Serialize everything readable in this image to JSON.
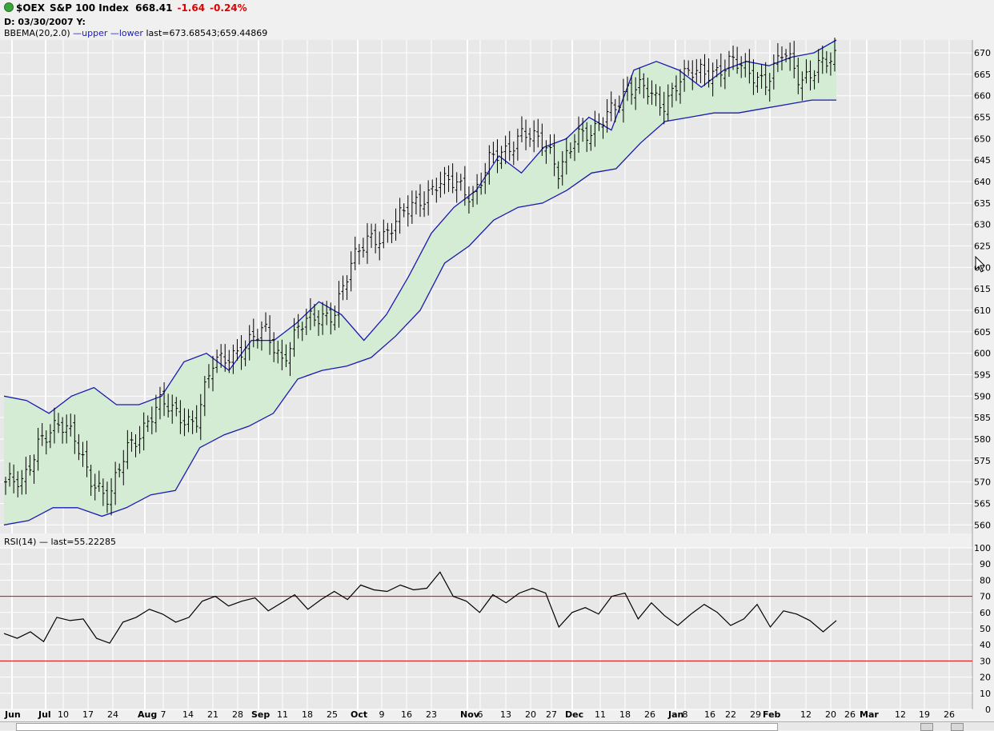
{
  "header": {
    "symbol": "$OEX",
    "name": "S&P 100 Index",
    "price": "668.41",
    "change": "-1.64",
    "change_pct": "-0.24%",
    "date_line": "D: 03/30/2007 Y:",
    "indicator_name": "BBEMA(20,2.0)",
    "upper_label": "upper",
    "lower_label": "lower",
    "last_label": "last=673.68543;659.44869",
    "status_color": "#3aa63a"
  },
  "rsi_panel": {
    "label": "RSI(14)",
    "last_label": "last=55.22285"
  },
  "colors": {
    "band_fill": "#d4ecd4",
    "band_line": "#1a1ab0",
    "price_bar": "#000000",
    "rsi_line": "#000000",
    "rsi_threshold": "#d40000",
    "grid": "#ffffff",
    "panel_bg": "#e8e8e8",
    "change_color": "#e00000"
  },
  "chart_data": [
    {
      "type": "line",
      "title": "$OEX S&P 100 Index",
      "panel": "price",
      "y_axis_side": "right",
      "ylim": [
        558,
        673
      ],
      "yticks": [
        560,
        565,
        570,
        575,
        580,
        585,
        590,
        595,
        600,
        605,
        610,
        615,
        620,
        625,
        630,
        635,
        640,
        645,
        650,
        655,
        660,
        665,
        670
      ],
      "grid": true,
      "x_labels": [
        "Jun",
        "Jul",
        "10",
        "17",
        "24",
        "Aug",
        "7",
        "14",
        "21",
        "28",
        "Sep",
        "11",
        "18",
        "25",
        "Oct",
        "9",
        "16",
        "23",
        "Nov",
        "6",
        "13",
        "20",
        "27",
        "Dec",
        "11",
        "18",
        "26",
        "Jan",
        "8",
        "16",
        "22",
        "29",
        "Feb",
        "12",
        "20",
        "26",
        "Mar",
        "12",
        "19",
        "26"
      ],
      "x_bold_labels": [
        "Jun",
        "Jul",
        "Aug",
        "Sep",
        "Oct",
        "Nov",
        "Dec",
        "Jan",
        "Feb",
        "Mar"
      ],
      "series": [
        {
          "name": "upper",
          "values": [
            590,
            589,
            586,
            590,
            592,
            588,
            588,
            590,
            598,
            600,
            596,
            603,
            603,
            607,
            612,
            609,
            603,
            609,
            618,
            628,
            634,
            638,
            646,
            642,
            648,
            650,
            655,
            652,
            666,
            668,
            666,
            662,
            666,
            668,
            667,
            669,
            670,
            673
          ]
        },
        {
          "name": "lower",
          "values": [
            560,
            561,
            564,
            564,
            562,
            564,
            567,
            568,
            578,
            581,
            583,
            586,
            594,
            596,
            597,
            599,
            604,
            610,
            621,
            625,
            631,
            634,
            635,
            638,
            642,
            643,
            649,
            654,
            655,
            656,
            656,
            657,
            658,
            659,
            659
          ]
        },
        {
          "name": "close",
          "values": [
            570,
            569,
            581,
            583,
            580,
            571,
            565,
            578,
            583,
            588,
            586,
            584,
            597,
            600,
            602,
            605,
            599,
            606,
            608,
            610,
            620,
            627,
            628,
            632,
            636,
            640,
            639,
            637,
            645,
            646,
            653,
            649,
            642,
            652,
            650,
            657,
            662,
            661,
            658,
            664,
            665,
            666,
            668,
            665,
            664,
            670,
            663,
            668,
            668
          ]
        }
      ]
    },
    {
      "type": "line",
      "title": "RSI(14)",
      "panel": "rsi",
      "y_axis_side": "right",
      "ylim": [
        0,
        100
      ],
      "yticks": [
        0,
        10,
        20,
        30,
        40,
        50,
        60,
        70,
        80,
        90,
        100
      ],
      "thresholds": [
        30,
        70
      ],
      "series": [
        {
          "name": "RSI",
          "values": [
            47,
            44,
            48,
            42,
            57,
            55,
            56,
            44,
            41,
            54,
            57,
            62,
            59,
            54,
            57,
            67,
            70,
            64,
            67,
            69,
            61,
            66,
            71,
            62,
            68,
            73,
            68,
            77,
            74,
            73,
            77,
            74,
            75,
            85,
            70,
            67,
            60,
            71,
            66,
            72,
            75,
            72,
            51,
            60,
            63,
            59,
            70,
            72,
            56,
            66,
            58,
            52,
            59,
            65,
            60,
            52,
            56,
            65,
            51,
            61,
            59,
            55,
            48,
            55
          ]
        }
      ]
    }
  ]
}
